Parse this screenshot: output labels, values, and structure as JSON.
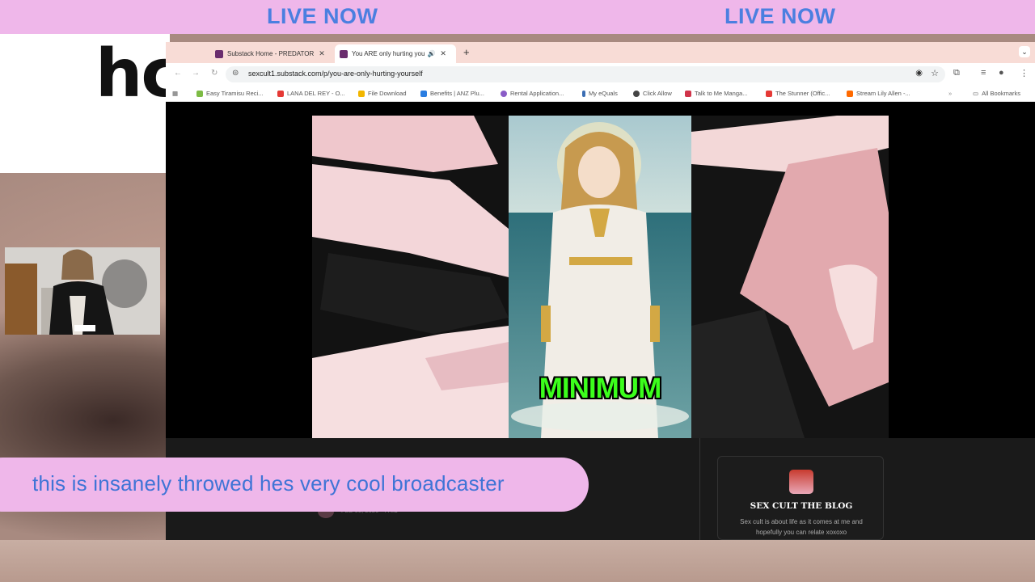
{
  "live_banner": {
    "left_label": "LIVE NOW",
    "right_label": "LIVE NOW"
  },
  "backdrop": {
    "partial_text": "hc"
  },
  "browser": {
    "tabs": [
      {
        "label": "Substack Home - PREDATOR",
        "active": false,
        "favicon": "substack-favicon"
      },
      {
        "label": "You ARE only hurting you",
        "active": true,
        "favicon": "substack-favicon",
        "audio_icon": "speaker-icon"
      }
    ],
    "new_tab_symbol": "+",
    "tab_menu_symbol": "⌄",
    "url": "sexcult1.substack.com/p/you-are-only-hurting-yourself",
    "bookmarks": [
      {
        "label": "Easy Tiramisu Reci...",
        "color": "#7dbb45"
      },
      {
        "label": "LANA DEL REY - O...",
        "color": "#e53935"
      },
      {
        "label": "File Download",
        "color": "#f2b600"
      },
      {
        "label": "Benefits | ANZ Plu...",
        "color": "#2a7de1"
      },
      {
        "label": "Rental Application...",
        "color": "#8a5cc7"
      },
      {
        "label": "My eQuals",
        "color": "#3b6db3"
      },
      {
        "label": "Click Allow",
        "color": "#444444"
      },
      {
        "label": "Talk to Me Manga...",
        "color": "#d0344a"
      },
      {
        "label": "The Stunner (Offic...",
        "color": "#e53935"
      },
      {
        "label": "Stream Lily Allen -...",
        "color": "#ff6a00"
      }
    ],
    "all_bookmarks": "All Bookmarks"
  },
  "video": {
    "caption": "MINIMUM"
  },
  "post": {
    "meta": "FEB 08, 2026 · PAID"
  },
  "blog_card": {
    "title": "SEX CULT THE BLOG",
    "description": "Sex cult is about life as it comes at me and hopefully you can relate xoxoxo"
  },
  "chat": {
    "message": "this is insanely throwed hes very cool broadcaster"
  },
  "colors": {
    "banner_pink": "#efb7ea",
    "banner_text_blue": "#4b7fe0",
    "caption_green": "#3cff1c"
  }
}
